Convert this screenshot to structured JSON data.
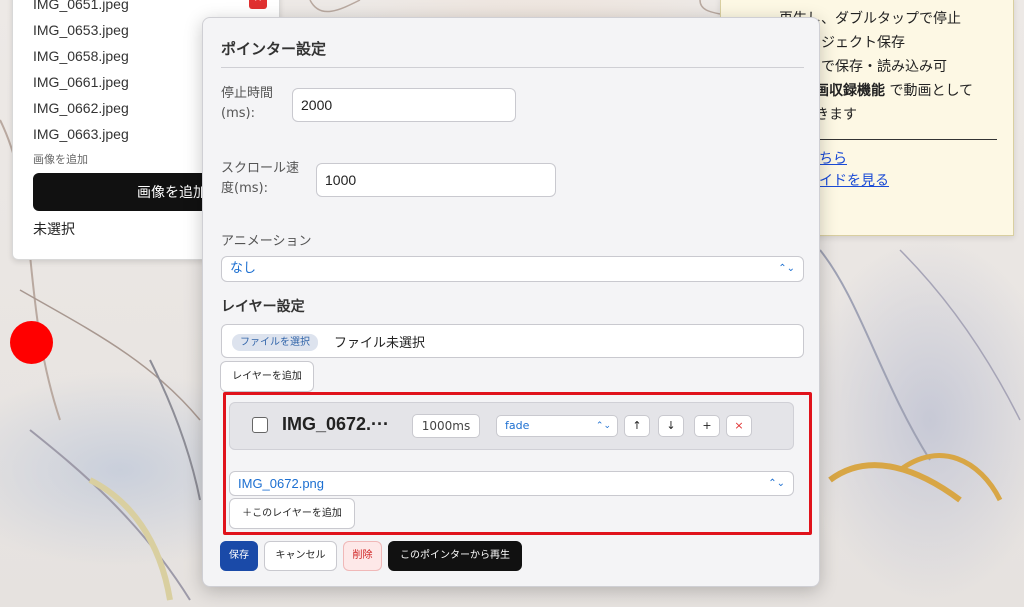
{
  "image_list": {
    "items": [
      "IMG_0651.jpeg",
      "IMG_0653.jpeg",
      "IMG_0658.jpeg",
      "IMG_0661.jpeg",
      "IMG_0662.jpeg",
      "IMG_0663.jpeg"
    ],
    "delete_icon": "×",
    "add_hint": "画像を追加",
    "add_button": "画像を追加",
    "selection_status": "未選択"
  },
  "help": {
    "line1": "再生し、ダブルタップで停止",
    "line2": "プロジェクト保存",
    "line3": "」で保存・読み込み可",
    "line4_bold": "画収録機能",
    "line4_rest": " で動画として",
    "line5": "きます",
    "link1": "ちら",
    "link2": "イドを見る"
  },
  "dialog": {
    "title": "ポインター設定",
    "stop_time_label": "停止時間(ms):",
    "stop_time_value": "2000",
    "scroll_speed_label": "スクロール速度(ms):",
    "scroll_speed_value": "1000",
    "animation_label": "アニメーション",
    "animation_value": "なし",
    "layer_section_title": "レイヤー設定",
    "file_button": "ファイルを選択",
    "file_status": "ファイル未選択",
    "add_layer_button": "レイヤーを追加",
    "layer": {
      "name": "IMG_0672.···",
      "duration": "1000ms",
      "animation": "fade",
      "up_icon": "↑",
      "down_icon": "↓",
      "plus_icon": "+",
      "delete_icon": "×",
      "image": "IMG_0672.png",
      "add_to_layer_button": "＋このレイヤーを追加"
    },
    "save_button": "保存",
    "cancel_button": "キャンセル",
    "delete_button": "削除",
    "play_from_here_button": "このポインターから再生"
  },
  "colors": {
    "accent_blue": "#1a4aa8",
    "link_blue": "#1c6fd1",
    "highlight_red": "#e0121b",
    "pointer_red": "#ff0000"
  }
}
